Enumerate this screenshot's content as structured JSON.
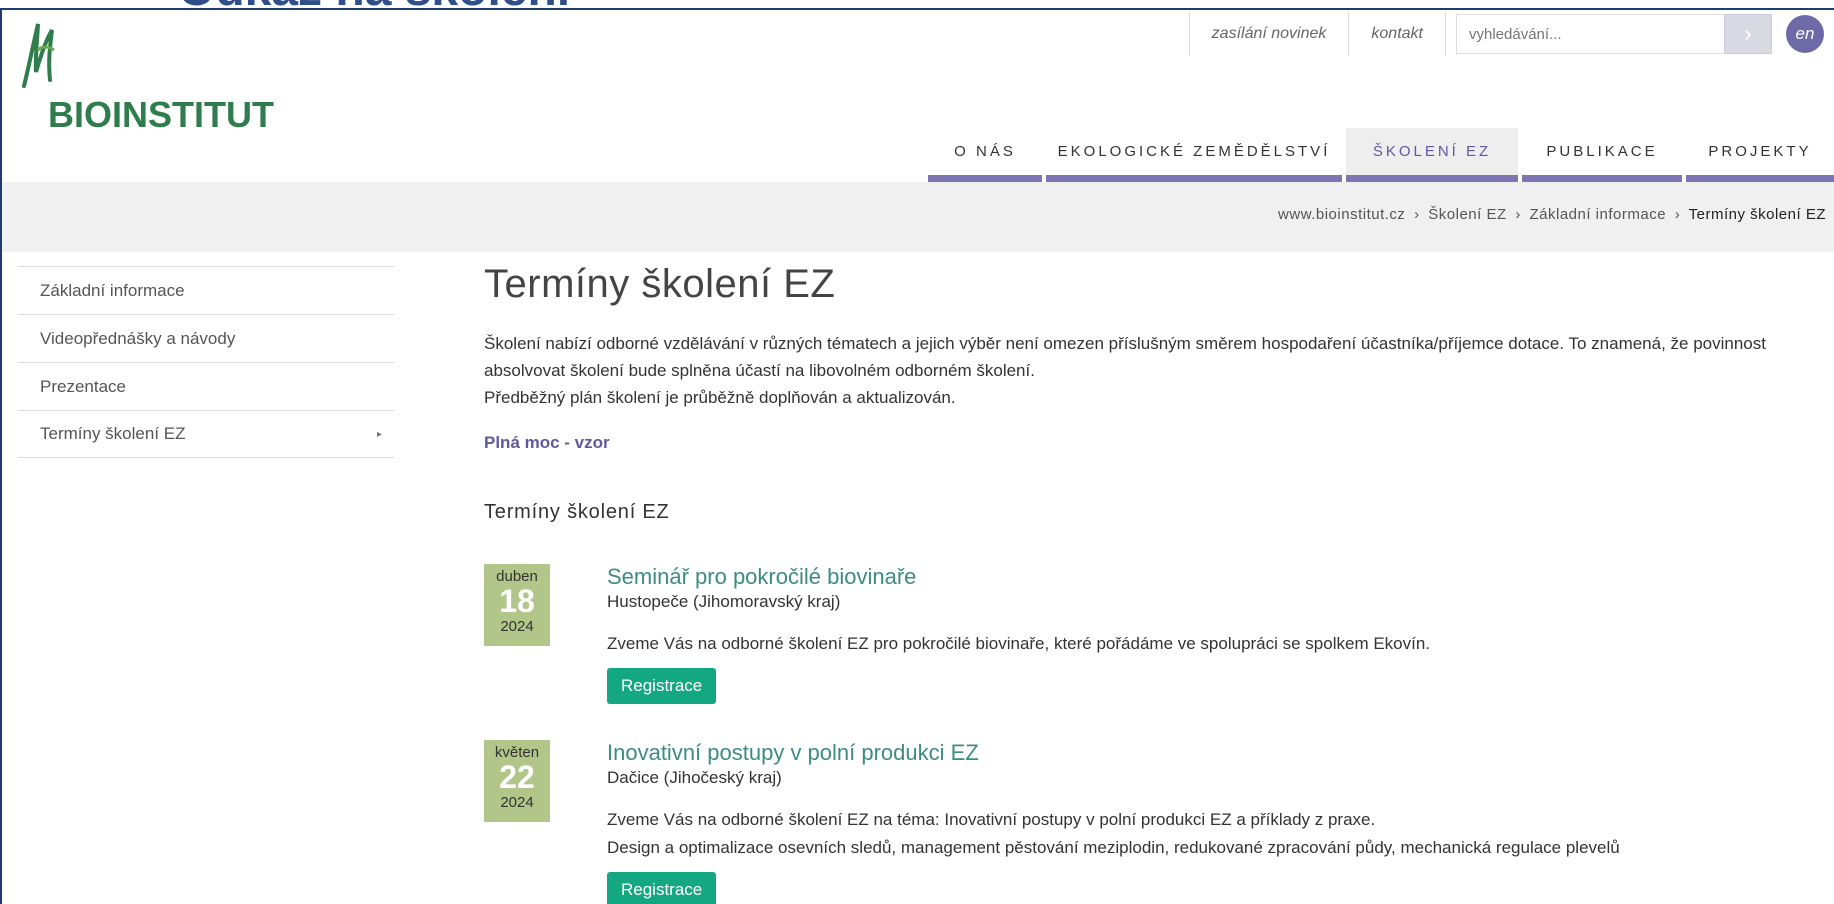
{
  "overlay": {
    "slide_title": "Odkaz na školení"
  },
  "brand": {
    "name": "BIOINSTITUT"
  },
  "topbar": {
    "newsletter": "zasílání novinek",
    "contact": "kontakt",
    "search_placeholder": "vyhledávání...",
    "search_button": "›",
    "language": "en"
  },
  "nav": {
    "items": [
      {
        "label": "O NÁS"
      },
      {
        "label": "EKOLOGICKÉ ZEMĚDĚLSTVÍ"
      },
      {
        "label": "ŠKOLENÍ EZ",
        "active": true
      },
      {
        "label": "PUBLIKACE"
      },
      {
        "label": "PROJEKTY"
      }
    ]
  },
  "breadcrumb": {
    "items": [
      "www.bioinstitut.cz",
      "Školení EZ",
      "Základní informace",
      "Termíny školení EZ"
    ],
    "separator": "›"
  },
  "sidebar": {
    "items": [
      {
        "label": "Základní informace"
      },
      {
        "label": "Videopřednášky a návody"
      },
      {
        "label": "Prezentace"
      },
      {
        "label": "Termíny školení EZ",
        "arrow": "▸"
      }
    ]
  },
  "main": {
    "title": "Termíny školení EZ",
    "intro_1": "Školení nabízí odborné vzdělávání v různých tématech a jejich výběr není omezen příslušným směrem hospodaření účastníka/příjemce dotace. To znamená, že povinnost absolvovat školení bude splněna účastí na libovolném odborném školení.",
    "intro_2": "Předběžný plán školení je průběžně doplňován a aktualizován.",
    "power_of_attorney_link": "Plná moc - vzor",
    "section_heading": "Termíny školení EZ",
    "events": [
      {
        "month": "duben",
        "day": "18",
        "year": "2024",
        "title": "Seminář pro pokročilé biovinaře",
        "place": "Hustopeče (Jihomoravský kraj)",
        "description": "Zveme Vás na odborné školení EZ pro pokročilé biovinaře, které pořádáme ve spolupráci se spolkem Ekovín.",
        "description_2": "",
        "button": "Registrace"
      },
      {
        "month": "květen",
        "day": "22",
        "year": "2024",
        "title": "Inovativní postupy v polní produkci EZ",
        "place": "Dačice (Jihočeský kraj)",
        "description": "Zveme Vás na odborné školení EZ na téma: Inovativní postupy v polní produkci EZ a příklady z praxe.",
        "description_2": "Design a optimalizace osevních sledů, management pěstování meziplodin, redukované zpracování půdy, mechanická regulace plevelů",
        "button": "Registrace"
      }
    ]
  },
  "colors": {
    "accent": "#7b76b0",
    "date_box": "#b3c68a",
    "event_title": "#3c8c84",
    "register_button": "#14a882",
    "logo_green": "#2f7d4d"
  }
}
